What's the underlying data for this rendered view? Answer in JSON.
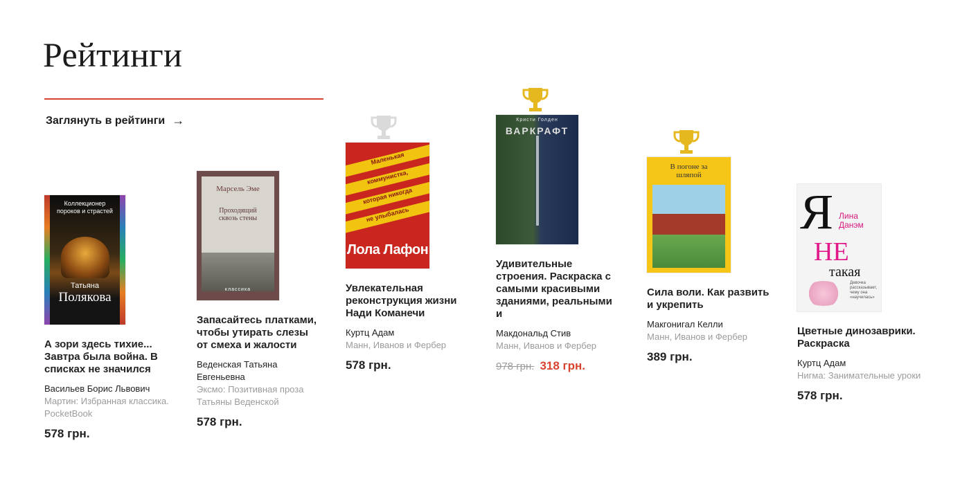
{
  "page": {
    "title": "Рейтинги",
    "ratings_link": "Заглянуть в рейтинги"
  },
  "colors": {
    "accent": "#d8432f",
    "gold": "#e6b820",
    "silver": "#d9d9d9"
  },
  "books": [
    {
      "rank_icon": "none",
      "cover": {
        "lines": [
          "Коллекционер",
          "пороков и страстей"
        ],
        "author": "Татьяна",
        "author2": "Полякова"
      },
      "title": "А зори здесь тихие... Завтра была война. В списках не значился",
      "author": "Васильев Борис Львович",
      "publisher": "Мартин: Избранная классика. PocketBook",
      "price": "578 грн."
    },
    {
      "rank_icon": "none",
      "cover": {
        "author": "Марсель Эме",
        "line": "Проходящий сквозь стены",
        "series": "классика"
      },
      "title": "Запасайтесь платками, чтобы утирать слезы от смеха и жалости",
      "author": "Веденская Татьяна Евгеньевна",
      "publisher": "Эксмо: Позитивная проза Татьяны Веденской",
      "price": "578 грн."
    },
    {
      "rank_icon": "silver-trophy-icon",
      "cover": {
        "line1": "Маленькая",
        "line2": "коммунистка,",
        "line3": "которая никогда",
        "line4": "не улыбалась",
        "author": "Лола Лафон"
      },
      "title": "Увлекательная реконструкция жизни Нади Команечи",
      "author": "Куртц Адам",
      "publisher": "Манн, Иванов и Фербер",
      "price": "578 грн."
    },
    {
      "rank_icon": "gold-trophy-icon",
      "cover": {
        "author": "Кристи Голден",
        "title": "Варкрафт"
      },
      "title": "Удивительные строения. Раскраска с самыми красивыми зданиями, реальными и",
      "author": "Макдональд Стив",
      "publisher": "Манн, Иванов и Фербер",
      "old_price": "978 грн.",
      "price": "318 грн."
    },
    {
      "rank_icon": "gold-trophy-icon",
      "cover": {
        "title": "В погоне за шляпой"
      },
      "title": "Сила воли. Как развить и укрепить",
      "author": "Макгонигал Келли",
      "publisher": "Манн, Иванов и Фербер",
      "price": "389 грн."
    },
    {
      "rank_icon": "none",
      "cover": {
        "big": "Я",
        "author": "Лина Данэм",
        "ne": "НЕ",
        "taya": "такая",
        "sub": "Девочка рассказывает, чему она «научилась»"
      },
      "title": "Цветные динозаврики. Раскраска",
      "author": "Куртц Адам",
      "publisher": "Нигма: Занимательные уроки",
      "price": "578 грн."
    }
  ]
}
